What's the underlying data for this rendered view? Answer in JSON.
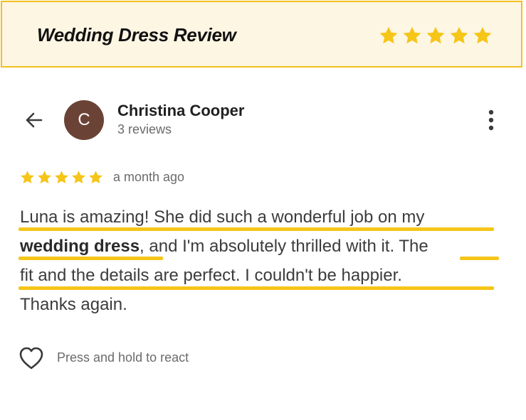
{
  "banner": {
    "title": "Wedding Dress Review",
    "star_count": 5,
    "star_color": "#f5c518",
    "border_color": "#f3c01c",
    "background_color": "#fdf6e3"
  },
  "header": {
    "back_icon": "arrow-left-icon",
    "avatar_initial": "C",
    "avatar_color": "#6b4336",
    "reviewer_name": "Christina Cooper",
    "review_count": "3 reviews",
    "menu_icon": "more-vertical-icon"
  },
  "rating": {
    "stars": 5,
    "date": "a month ago"
  },
  "review": {
    "line1": "Luna is amazing! She did such a wonderful job on my",
    "line2_bold": "wedding dress",
    "line2_rest": ", and I'm absolutely thrilled with it. The",
    "line3": "fit and the details are perfect. I couldn't be happier.",
    "line4": "Thanks again.",
    "highlight_color": "#f5c518"
  },
  "react": {
    "icon": "heart-outline-icon",
    "label": "Press and hold to react"
  }
}
